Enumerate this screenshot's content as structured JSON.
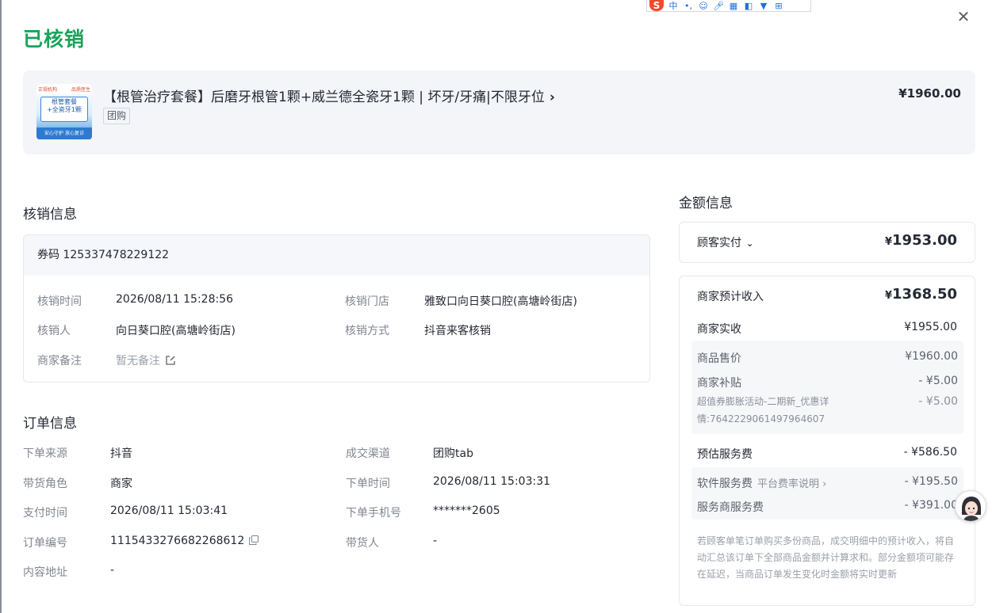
{
  "ime": {
    "logo": "S",
    "mode": "中",
    "punct": "•,"
  },
  "status": {
    "title": "已核销"
  },
  "product": {
    "title": "【根管治疗套餐】后磨牙根管1颗+威兰德全瓷牙1颗 | 坏牙/牙痛|不限牙位",
    "chevron": "›",
    "tag": "团购",
    "price": "¥1960.00",
    "thumb": {
      "top_left": "正规机构",
      "top_right": "品质医生",
      "line1": "根管套餐",
      "line2": "+全瓷牙1颗",
      "bottom": "安心守护 放心复诊"
    }
  },
  "verify": {
    "section_title": "核销信息",
    "code_label": "券码",
    "code_value": "125337478229122",
    "rows": [
      {
        "label": "核销时间",
        "value": "2026/08/11 15:28:56"
      },
      {
        "label": "核销门店",
        "value": "雅致口向日葵口腔(高塘岭街店)"
      },
      {
        "label": "核销人",
        "value": "向日葵口腔(高塘岭街店)"
      },
      {
        "label": "核销方式",
        "value": "抖音来客核销"
      },
      {
        "label": "商家备注",
        "value": "暂无备注"
      }
    ]
  },
  "order": {
    "section_title": "订单信息",
    "rows": [
      {
        "label": "下单来源",
        "value": "抖音"
      },
      {
        "label": "成交渠道",
        "value": "团购tab"
      },
      {
        "label": "带货角色",
        "value": "商家"
      },
      {
        "label": "下单时间",
        "value": "2026/08/11 15:03:31"
      },
      {
        "label": "支付时间",
        "value": "2026/08/11 15:03:41"
      },
      {
        "label": "下单手机号",
        "value": "*******2605"
      },
      {
        "label": "订单编号",
        "value": "1115433276682268612"
      },
      {
        "label": "带货人",
        "value": "-"
      },
      {
        "label": "内容地址",
        "value": "-"
      }
    ]
  },
  "amount": {
    "section_title": "金额信息",
    "customer_paid_label": "顾客实付",
    "customer_paid_currency": "¥",
    "customer_paid_value": "1953.00",
    "expected_income_label": "商家预计收入",
    "expected_income_currency": "¥",
    "expected_income_value": "1368.50",
    "actual_received_label": "商家实收",
    "actual_received_value": "¥1955.00",
    "goods_price_label": "商品售价",
    "goods_price_value": "¥1960.00",
    "subsidy_label": "商家补贴",
    "subsidy_value": "- ¥5.00",
    "subsidy_detail_label": "超值券膨胀活动-二期新_优惠详情:7642229061497964607",
    "subsidy_detail_value": "- ¥5.00",
    "service_fee_label": "预估服务费",
    "service_fee_value": "- ¥586.50",
    "software_fee_label": "软件服务费",
    "software_fee_link": "平台费率说明 ›",
    "software_fee_value": "- ¥195.50",
    "provider_fee_label": "服务商服务费",
    "provider_fee_value": "- ¥391.00",
    "note": "若顾客单笔订单购买多份商品，成交明细中的预计收入，将自动汇总该订单下全部商品金额并计算求和。部分金额项可能存在延迟，当商品订单发生变化时金额将实时更新"
  },
  "colors": {
    "success": "#19a35b",
    "text": "#252933",
    "muted": "#80868f",
    "panel": "#f3f5f8"
  }
}
